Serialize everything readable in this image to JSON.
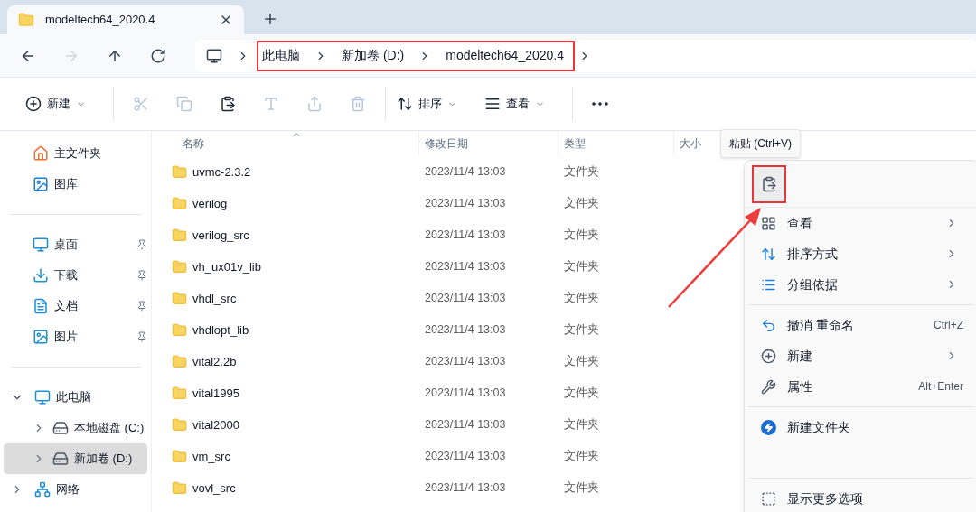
{
  "tab": {
    "title": "modeltech64_2020.4",
    "selected": true
  },
  "nav": [
    {
      "kind": "back",
      "disabled": false
    },
    {
      "kind": "forward",
      "disabled": true
    },
    {
      "kind": "up",
      "disabled": false
    },
    {
      "kind": "refresh",
      "disabled": false
    }
  ],
  "breadcrumb": [
    "此电脑",
    "新加卷 (D:)",
    "modeltech64_2020.4"
  ],
  "toolbar": [
    {
      "kind": "new",
      "label": "新建",
      "disabled": false
    },
    {
      "kind": "cut",
      "disabled": true
    },
    {
      "kind": "copy",
      "disabled": true
    },
    {
      "kind": "paste",
      "disabled": false
    },
    {
      "kind": "rename",
      "disabled": true
    },
    {
      "kind": "share",
      "disabled": true
    },
    {
      "kind": "delete",
      "disabled": true
    },
    {
      "kind": "sort",
      "label": "排序",
      "disabled": false
    },
    {
      "kind": "view",
      "label": "查看",
      "disabled": false
    },
    {
      "kind": "more",
      "disabled": false
    }
  ],
  "sidebar": {
    "top": [
      {
        "label": "主文件夹"
      },
      {
        "label": "图库"
      }
    ],
    "quick": [
      {
        "label": "桌面",
        "pinned": true
      },
      {
        "label": "下载",
        "pinned": true
      },
      {
        "label": "文档",
        "pinned": true
      },
      {
        "label": "图片",
        "pinned": true
      }
    ],
    "tree": [
      {
        "label": "此电脑",
        "expanded": true,
        "selected": false,
        "children": [
          {
            "label": "本地磁盘 (C:)",
            "expanded": false,
            "selected": false
          },
          {
            "label": "新加卷 (D:)",
            "expanded": false,
            "selected": true
          }
        ]
      },
      {
        "label": "网络",
        "expanded": false,
        "selected": false
      }
    ]
  },
  "table": {
    "columns": [
      "名称",
      "修改日期",
      "类型",
      "大小"
    ],
    "rows": [
      {
        "name": "uvmc-2.3.2",
        "date": "2023/11/4 13:03",
        "type": "文件夹"
      },
      {
        "name": "verilog",
        "date": "2023/11/4 13:03",
        "type": "文件夹"
      },
      {
        "name": "verilog_src",
        "date": "2023/11/4 13:03",
        "type": "文件夹"
      },
      {
        "name": "vh_ux01v_lib",
        "date": "2023/11/4 13:03",
        "type": "文件夹"
      },
      {
        "name": "vhdl_src",
        "date": "2023/11/4 13:03",
        "type": "文件夹"
      },
      {
        "name": "vhdlopt_lib",
        "date": "2023/11/4 13:03",
        "type": "文件夹"
      },
      {
        "name": "vital2.2b",
        "date": "2023/11/4 13:03",
        "type": "文件夹"
      },
      {
        "name": "vital1995",
        "date": "2023/11/4 13:03",
        "type": "文件夹"
      },
      {
        "name": "vital2000",
        "date": "2023/11/4 13:03",
        "type": "文件夹"
      },
      {
        "name": "vm_src",
        "date": "2023/11/4 13:03",
        "type": "文件夹"
      },
      {
        "name": "vovl_src",
        "date": "2023/11/4 13:03",
        "type": "文件夹"
      }
    ]
  },
  "tooltip": "粘贴 (Ctrl+V)",
  "menu": [
    {
      "kind": "icon-row"
    },
    {
      "kind": "item",
      "label": "查看",
      "submenu": true
    },
    {
      "kind": "item",
      "label": "排序方式",
      "submenu": true
    },
    {
      "kind": "item",
      "label": "分组依据",
      "submenu": true
    },
    {
      "kind": "separator"
    },
    {
      "kind": "item",
      "label": "撤消 重命名",
      "shortcut": "Ctrl+Z"
    },
    {
      "kind": "item",
      "label": "新建",
      "submenu": true
    },
    {
      "kind": "item",
      "label": "属性",
      "shortcut": "Alt+Enter"
    },
    {
      "kind": "separator"
    },
    {
      "kind": "item",
      "label": "新建文件夹"
    },
    {
      "kind": "gap"
    },
    {
      "kind": "separator"
    },
    {
      "kind": "item",
      "label": "显示更多选项"
    }
  ]
}
